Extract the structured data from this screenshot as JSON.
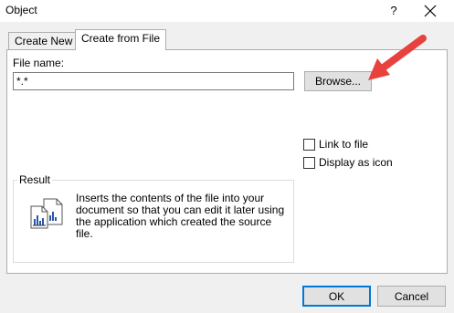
{
  "window": {
    "title": "Object",
    "help_label": "?"
  },
  "tabs": [
    {
      "label": "Create New"
    },
    {
      "label": "Create from File"
    }
  ],
  "file": {
    "label": "File name:",
    "value": "*.*"
  },
  "browse_label": "Browse...",
  "options": {
    "link_label": "Link to file",
    "link_checked": false,
    "display_label": "Display as icon",
    "display_checked": false
  },
  "result": {
    "title": "Result",
    "text": "Inserts the contents of the file into your document so that you can edit it later using the application which created the source file."
  },
  "buttons": {
    "ok": "OK",
    "cancel": "Cancel"
  },
  "colors": {
    "arrow": "#e8423e",
    "accent": "#0078d7"
  }
}
